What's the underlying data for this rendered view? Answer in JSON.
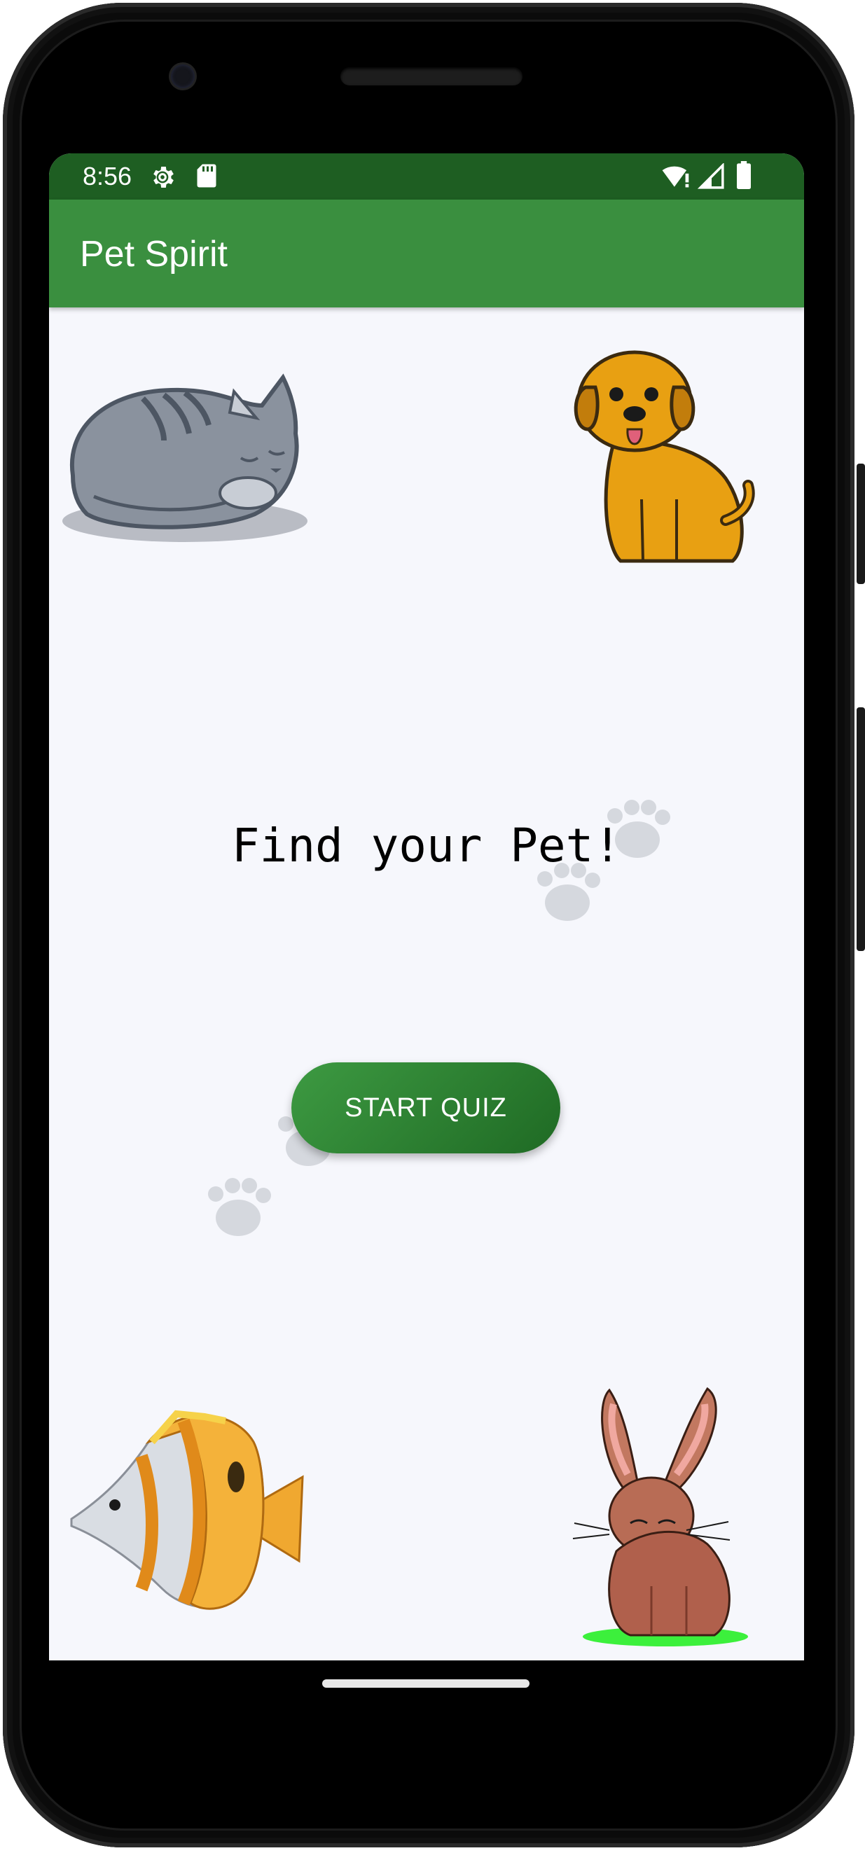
{
  "status_bar": {
    "time": "8:56",
    "icons": [
      "gear-icon",
      "sd-card-icon",
      "wifi-icon",
      "cell-signal-icon",
      "battery-icon"
    ]
  },
  "app_bar": {
    "title": "Pet Spirit"
  },
  "main": {
    "headline": "Find your Pet!",
    "start_button_label": "START QUIZ",
    "images": [
      "cat-image",
      "dog-image",
      "fish-image",
      "rabbit-image"
    ]
  },
  "colors": {
    "status_bar": "#1e5e22",
    "app_bar": "#3a8f3f",
    "button_gradient_start": "#3d9a42",
    "button_gradient_end": "#1f6a24",
    "screen_background": "#f6f7fc"
  }
}
